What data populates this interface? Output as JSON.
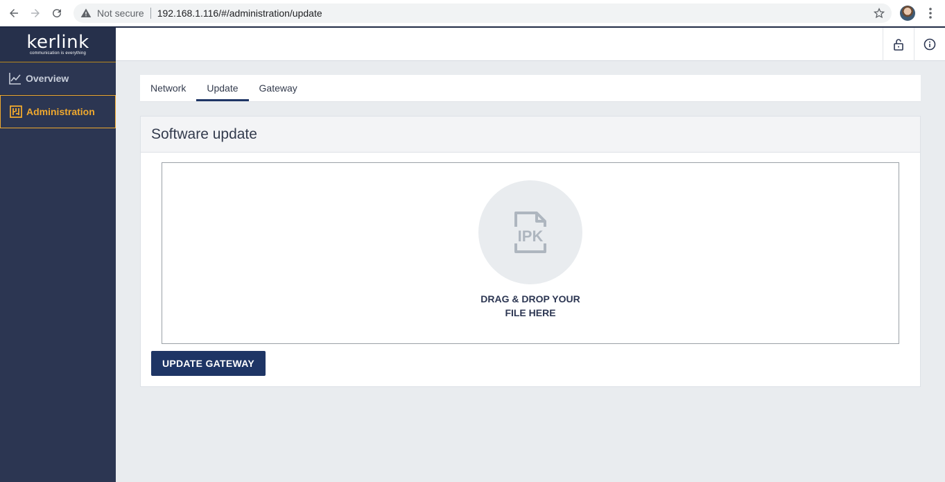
{
  "browser": {
    "security_label": "Not secure",
    "url": "192.168.1.116/#/administration/update"
  },
  "logo": {
    "name": "kerlink",
    "tagline": "communication is everything"
  },
  "sidebar": {
    "items": [
      {
        "label": "Overview",
        "icon": "chart-line-icon",
        "active": false
      },
      {
        "label": "Administration",
        "icon": "admin-grid-icon",
        "active": true
      }
    ]
  },
  "topbar": {
    "buttons": [
      {
        "icon": "lock-open-icon"
      },
      {
        "icon": "info-icon"
      }
    ]
  },
  "tabs": [
    {
      "label": "Network",
      "active": false
    },
    {
      "label": "Update",
      "active": true
    },
    {
      "label": "Gateway",
      "active": false
    }
  ],
  "card": {
    "title": "Software update",
    "dropzone": {
      "icon": "ipk-file-icon",
      "icon_text": "IPK",
      "line1": "DRAG & DROP YOUR",
      "line2": "FILE HERE"
    },
    "button_label": "UPDATE GATEWAY"
  },
  "colors": {
    "sidebar_bg": "#2c3652",
    "accent": "#f0a92e",
    "primary": "#1e3565"
  }
}
